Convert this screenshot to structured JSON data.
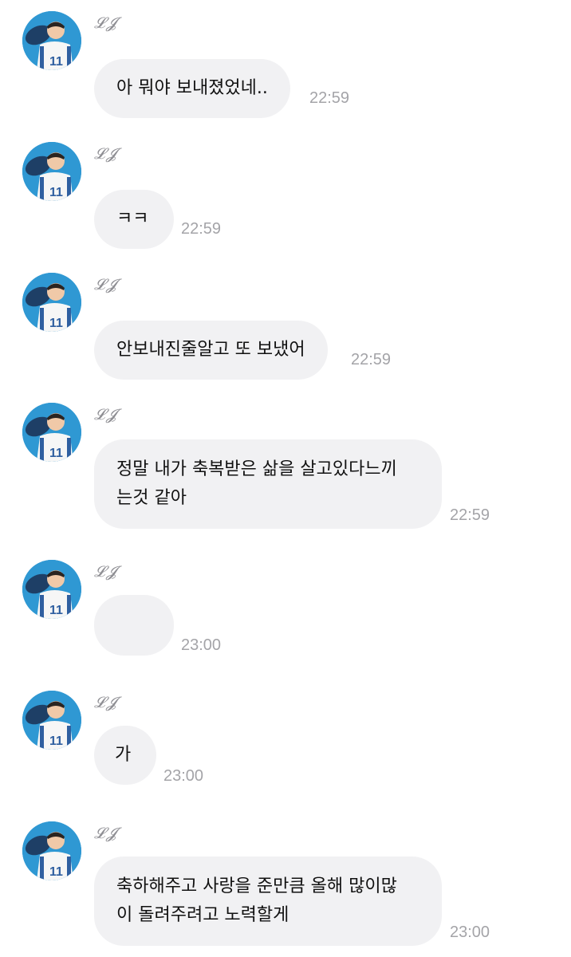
{
  "sender_name": "𝓛𝓙",
  "messages": [
    {
      "text": "아 뭐야 보내졌었네..",
      "time": "22:59"
    },
    {
      "text": "ㅋㅋ",
      "time": "22:59"
    },
    {
      "text": "안보내진줄알고 또 보냈어",
      "time": "22:59"
    },
    {
      "text": "정말 내가 축복받은 삶을 살고있다느끼\n는것 같아",
      "time": "22:59"
    },
    {
      "text": "",
      "time": "23:00"
    },
    {
      "text": "가",
      "time": "23:00"
    },
    {
      "text": "축하해주고 사랑을 준만큼 올해 많이많\n이 돌려주려고 노력할게",
      "time": "23:00"
    }
  ],
  "colors": {
    "bubble": "#f1f1f3",
    "timestamp": "#a4a4a8",
    "sender": "#8e8e93",
    "avatar_bg": "#2f98d3"
  },
  "icons": [
    "avatar-photo"
  ]
}
